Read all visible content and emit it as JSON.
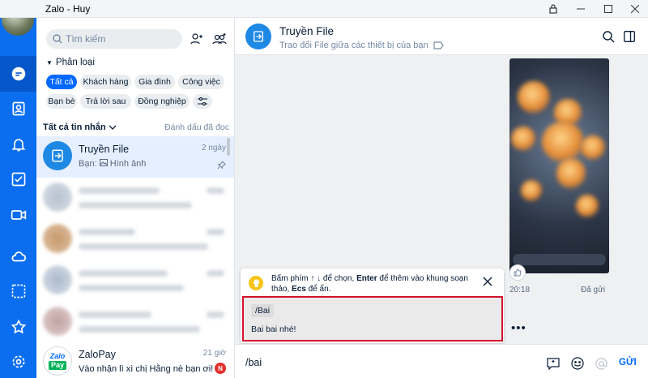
{
  "window": {
    "title": "Zalo - Huy"
  },
  "rail": {
    "items": [
      "chat-icon",
      "contacts-icon",
      "bell-icon",
      "todo-icon",
      "video-icon",
      "cloud-icon",
      "screenshot-icon",
      "star-icon",
      "settings-icon"
    ]
  },
  "sidebar": {
    "search_placeholder": "Tìm kiếm",
    "classify_label": "Phân loại",
    "chips": [
      "Tất cả",
      "Khách hàng",
      "Gia đình",
      "Công việc",
      "Bạn bè",
      "Trả lời sau",
      "Đồng nghiệp"
    ],
    "list_filter": "Tất cả tin nhắn",
    "mark_read": "Đánh dấu đã đọc",
    "conversations": [
      {
        "name": "Truyền File",
        "time": "2 ngày",
        "preview_prefix": "Bạn:",
        "preview": "Hình ảnh"
      },
      {
        "name": "ZaloPay",
        "time": "21 giờ",
        "preview": "Vào nhận lì xì chị Hằng nè bạn ơi!",
        "badge": "N",
        "avatar_text_top": "Zalo",
        "avatar_text_bottom": "Pay"
      }
    ]
  },
  "chat": {
    "title": "Truyền File",
    "subtitle": "Trao đổi File giữa các thiết bị của bạn",
    "message_time": "20:18",
    "message_status": "Đã gửi",
    "more": "•••"
  },
  "hint_popup": {
    "text_a": "Bấm phím ↑ ↓ để chọn,",
    "key_enter": "Enter",
    "text_b": "để thêm vào khung soạn thảo,",
    "key_esc": "Ecs",
    "text_c": "để ẩn."
  },
  "quick_reply": {
    "shortcut": "/Bai",
    "message": "Bai bai nhé!"
  },
  "composer": {
    "value": "/bai",
    "send_label": "GỬI"
  },
  "colors": {
    "brand": "#0068ff",
    "rail": "#0b6ef0",
    "highlight": "#d3122e"
  }
}
